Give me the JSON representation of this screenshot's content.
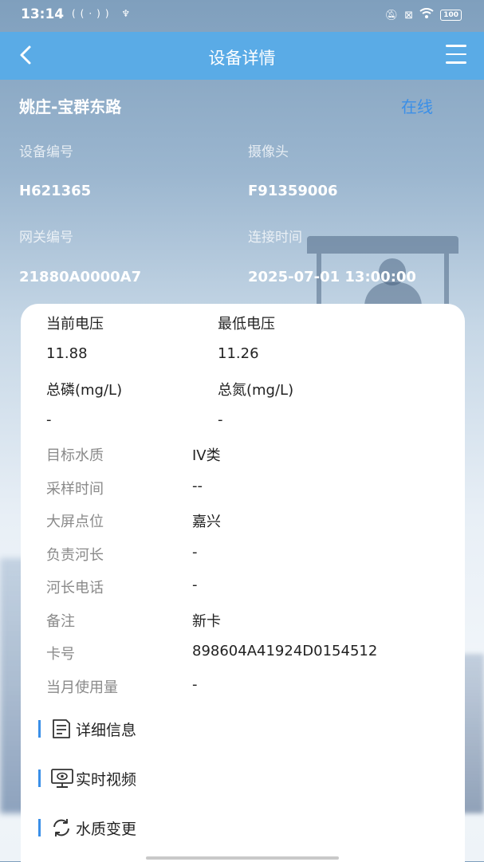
{
  "status_bar": {
    "time": "13:14",
    "battery": "100"
  },
  "navbar": {
    "title": "设备详情"
  },
  "device": {
    "name": "姚庄-宝群东路",
    "status": "在线",
    "status_color": "#3a8fe8",
    "fields": [
      {
        "label": "设备编号",
        "value": "H621365"
      },
      {
        "label": "摄像头",
        "value": "F91359006"
      },
      {
        "label": "网关编号",
        "value": "21880A0000A7"
      },
      {
        "label": "连接时间",
        "value": "2025-07-01 13:00:00"
      }
    ]
  },
  "metrics": [
    {
      "label": "当前电压",
      "value": "11.88"
    },
    {
      "label": "最低电压",
      "value": "11.26"
    },
    {
      "label": "总磷(mg/L)",
      "value": "-"
    },
    {
      "label": "总氮(mg/L)",
      "value": "-"
    }
  ],
  "details": [
    {
      "label": "目标水质",
      "value": "IV类"
    },
    {
      "label": "采样时间",
      "value": "--"
    },
    {
      "label": "大屏点位",
      "value": "嘉兴"
    },
    {
      "label": "负责河长",
      "value": "-"
    },
    {
      "label": "河长电话",
      "value": "-"
    },
    {
      "label": "备注",
      "value": "新卡"
    },
    {
      "label": "卡号",
      "value": "898604A41924D0154512"
    },
    {
      "label": "当月使用量",
      "value": "-"
    }
  ],
  "actions": [
    {
      "label": "详细信息",
      "icon": "document-icon"
    },
    {
      "label": "实时视频",
      "icon": "monitor-icon"
    },
    {
      "label": "水质变更",
      "icon": "refresh-icon"
    }
  ],
  "colors": {
    "navbar": "#5aabe6",
    "accent": "#3a8fe8"
  }
}
